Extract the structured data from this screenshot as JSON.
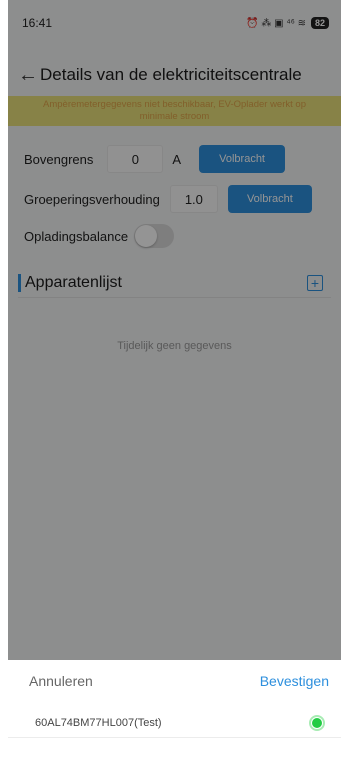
{
  "status_bar": {
    "time": "16:41",
    "icons_text": "⏰ ⁂ ▣ ⁴⁶ ≋",
    "battery": "82"
  },
  "header": {
    "back_icon": "back-arrow-icon",
    "title": "Details van de elektriciteitscentrale"
  },
  "warning": {
    "line1": "Ampèremetergegevens niet beschikbaar, EV-Oplader werkt op",
    "line2": "minimale stroom",
    "text_color": "#e0a44a",
    "background": "#e8e17a"
  },
  "settings": {
    "upper_limit_label": "Bovengrens",
    "upper_limit_value": "0",
    "upper_limit_unit": "A",
    "upper_limit_button": "Volbracht",
    "grouping_label": "Groeperingsverhouding",
    "grouping_value": "1.0",
    "grouping_button": "Volbracht",
    "balance_label": "Opladingsbalance",
    "balance_on": false
  },
  "device_list": {
    "title": "Apparatenlijst",
    "add_icon": "plus-square-icon",
    "empty_text": "Tijdelijk geen gegevens"
  },
  "sheet": {
    "cancel_label": "Annuleren",
    "confirm_label": "Bevestigen",
    "options": [
      {
        "label": "60AL74BM77HL007(Test)",
        "selected": true
      }
    ]
  },
  "colors": {
    "accent": "#2d8fdd",
    "selected_green": "#22cc44"
  }
}
